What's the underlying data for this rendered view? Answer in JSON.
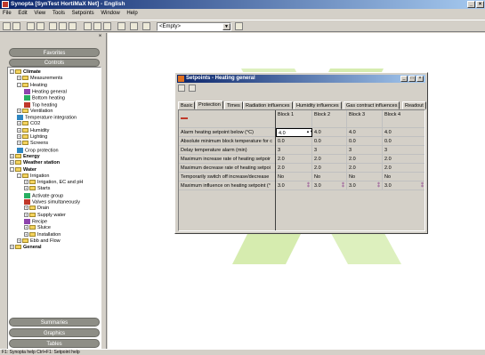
{
  "app": {
    "title": "Synopta [SynTest HortiMaX Net] - English"
  },
  "menu": [
    "File",
    "Edit",
    "View",
    "Tools",
    "Setpoints",
    "Window",
    "Help"
  ],
  "toolbar": {
    "selector_value": "<Empty>"
  },
  "sidebar": {
    "top_buttons": [
      "Favorites",
      "Controls"
    ],
    "bottom_buttons": [
      "Summaries",
      "Graphics",
      "Tables"
    ],
    "tree": [
      {
        "label": "Climate",
        "level": 0,
        "bold": true,
        "pm": "-"
      },
      {
        "label": "Measurements",
        "level": 1,
        "pm": "+"
      },
      {
        "label": "Heating",
        "level": 1,
        "pm": "-"
      },
      {
        "label": "Heating general",
        "level": 2
      },
      {
        "label": "Bottom heating",
        "level": 2
      },
      {
        "label": "Top heating",
        "level": 2
      },
      {
        "label": "Ventilation",
        "level": 1,
        "pm": "+"
      },
      {
        "label": "Temperature integration",
        "level": 1
      },
      {
        "label": "CO2",
        "level": 1,
        "pm": "+"
      },
      {
        "label": "Humidity",
        "level": 1,
        "pm": "+"
      },
      {
        "label": "Lighting",
        "level": 1,
        "pm": "+"
      },
      {
        "label": "Screens",
        "level": 1,
        "pm": "+"
      },
      {
        "label": "Crop protection",
        "level": 1
      },
      {
        "label": "Energy",
        "level": 0,
        "bold": true,
        "pm": "+"
      },
      {
        "label": "Weather station",
        "level": 0,
        "bold": true,
        "pm": "+"
      },
      {
        "label": "Water",
        "level": 0,
        "bold": true,
        "pm": "-"
      },
      {
        "label": "Irrigation",
        "level": 1,
        "pm": "-"
      },
      {
        "label": "Irrigation, EC and pH",
        "level": 2,
        "pm": "+"
      },
      {
        "label": "Starts",
        "level": 2,
        "pm": "+"
      },
      {
        "label": "Activate group",
        "level": 2
      },
      {
        "label": "Valves simultaneously",
        "level": 2
      },
      {
        "label": "Drain",
        "level": 2,
        "pm": "+"
      },
      {
        "label": "Supply water",
        "level": 2,
        "pm": "+"
      },
      {
        "label": "Recipe",
        "level": 2
      },
      {
        "label": "Sluice",
        "level": 2,
        "pm": "+"
      },
      {
        "label": "Installation",
        "level": 2,
        "pm": "+"
      },
      {
        "label": "Ebb and Flow",
        "level": 1,
        "pm": "+"
      },
      {
        "label": "General",
        "level": 0,
        "bold": true,
        "pm": "+"
      }
    ]
  },
  "setpoints_window": {
    "title": "Setpoints - Heating general",
    "tabs": [
      "Basic",
      "Protection",
      "Times",
      "Radiation influences",
      "Humidity influences",
      "Gas contract influences",
      "Readout"
    ],
    "active_tab": "Protection",
    "columns": [
      "Block 1",
      "Block 2",
      "Block 3",
      "Block 4"
    ],
    "rows": [
      {
        "label": "Alarm heating setpoint below (°C)",
        "values": [
          "4.0",
          "4.0",
          "4.0",
          "4.0"
        ]
      },
      {
        "label": "Absolute minimum block temperature for c",
        "values": [
          "0.0",
          "0.0",
          "0.0",
          "0.0"
        ]
      },
      {
        "label": "Delay temperature alarm (min)",
        "values": [
          "3",
          "3",
          "3",
          "3"
        ]
      },
      {
        "label": "Maximum increase rate of heating setpoir",
        "values": [
          "2.0",
          "2.0",
          "2.0",
          "2.0"
        ]
      },
      {
        "label": "Maximum decrease rate of heating setpoi",
        "values": [
          "2.0",
          "2.0",
          "2.0",
          "2.0"
        ]
      },
      {
        "label": "Temporarily switch off increase/decrease",
        "values": [
          "No",
          "No",
          "No",
          "No"
        ]
      },
      {
        "label": "Maximum influence on heating setpoint (°",
        "values": [
          "3.0",
          "3.0",
          "3.0",
          "3.0"
        ]
      }
    ]
  },
  "status": {
    "text": "F1: Synopta help  Ctrl+F1: Setpoint help"
  },
  "colors": {
    "titlebar": "#0a246a",
    "logo_green": "#b5dd6e"
  }
}
